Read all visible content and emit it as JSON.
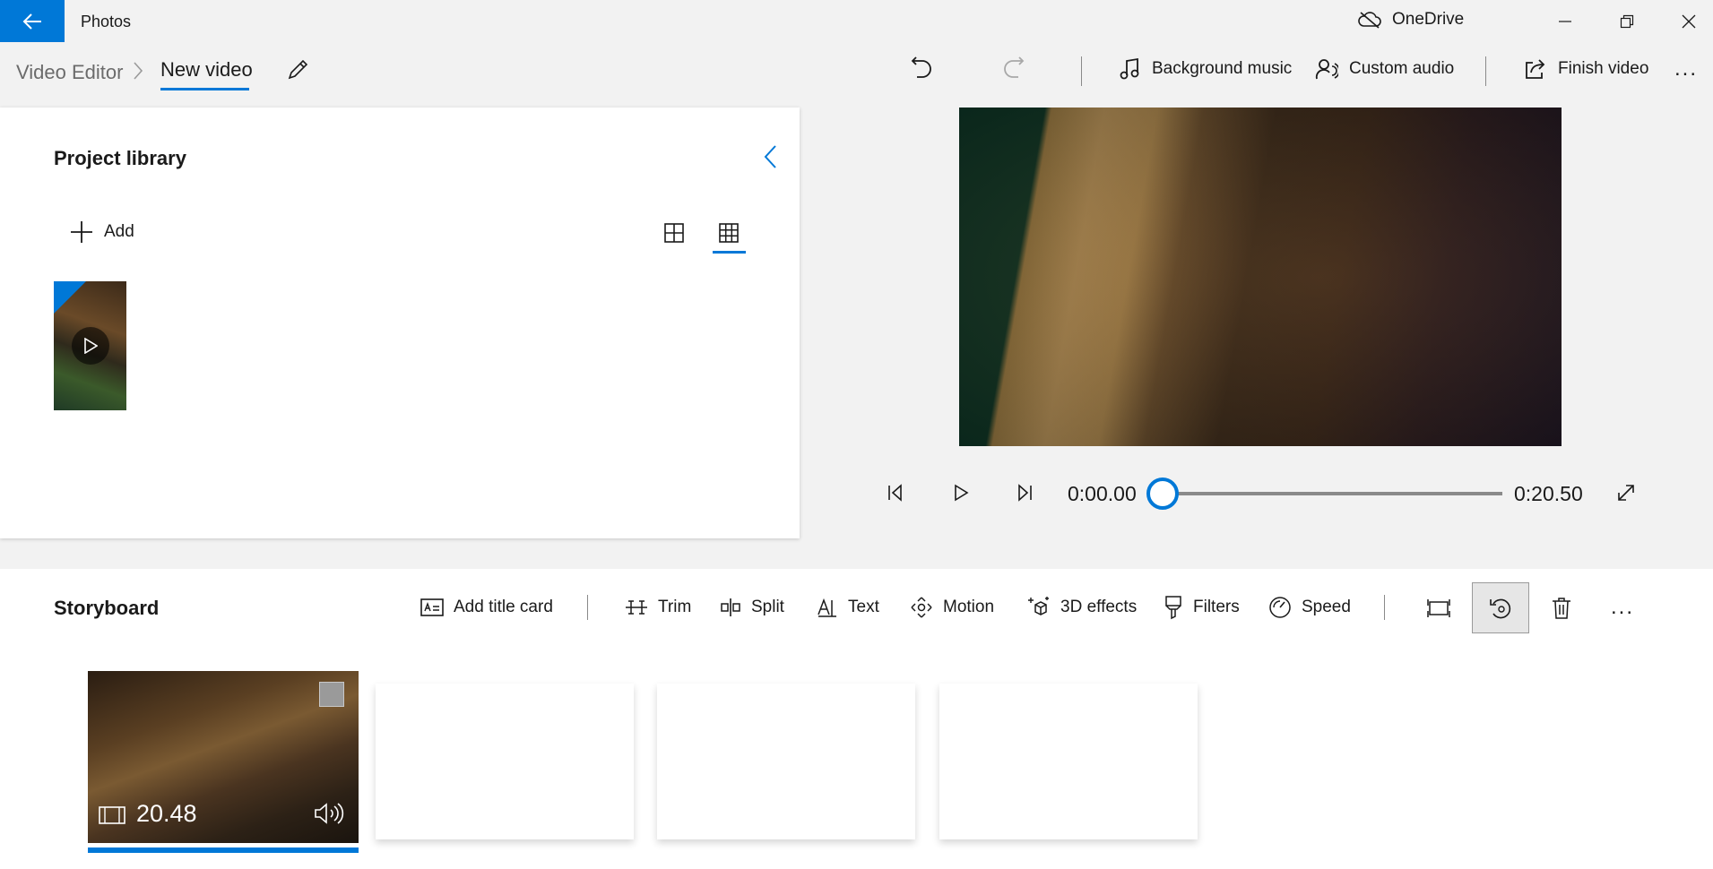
{
  "window": {
    "app_title": "Photos",
    "onedrive_label": "OneDrive",
    "accent_color": "#0078d7"
  },
  "breadcrumb": {
    "root": "Video Editor",
    "current": "New video"
  },
  "toolbar": {
    "undo": "undo-icon",
    "redo": "redo-icon",
    "background_music": "Background music",
    "custom_audio": "Custom audio",
    "finish_video": "Finish video",
    "more": "..."
  },
  "library": {
    "title": "Project library",
    "add_label": "Add",
    "view_modes": [
      "large-grid-icon",
      "small-grid-icon"
    ],
    "selected_view": "small-grid-icon",
    "items": [
      {
        "type": "video"
      }
    ]
  },
  "player": {
    "current_time": "0:00.00",
    "total_time": "0:20.50",
    "position_fraction": 0
  },
  "storyboard": {
    "title": "Storyboard",
    "tools": {
      "add_title_card": "Add title card",
      "trim": "Trim",
      "split": "Split",
      "text": "Text",
      "motion": "Motion",
      "effects_3d": "3D effects",
      "filters": "Filters",
      "speed": "Speed"
    },
    "icon_tools": [
      "remove-black-bars-icon",
      "rotate-icon",
      "delete-icon"
    ],
    "selected_icon_tool": "rotate-icon",
    "more": "...",
    "clips": [
      {
        "duration": "20.48",
        "has_audio": true,
        "selected": true
      }
    ],
    "empty_slots": 3
  }
}
